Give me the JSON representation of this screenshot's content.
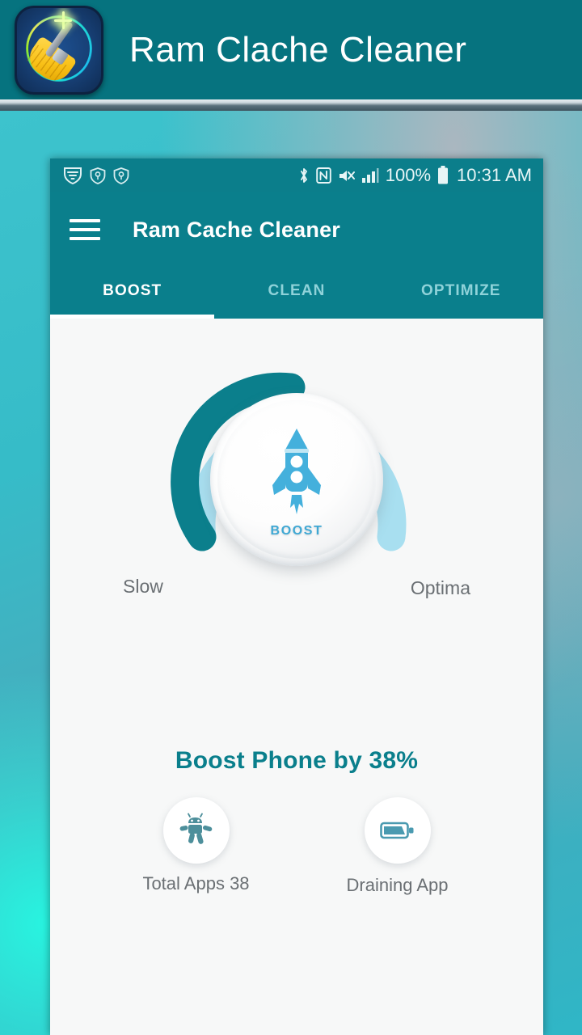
{
  "promo": {
    "title": "Ram Clache Cleaner",
    "icon_name": "broom-app-icon"
  },
  "phone": {
    "status_bar": {
      "left_icons": [
        "wifi-shield-icon",
        "key-shield-icon",
        "key-shield-icon"
      ],
      "right_icons": [
        "bluetooth-icon",
        "nfc-icon",
        "mute-icon",
        "signal-icon"
      ],
      "battery_percent": "100%",
      "battery_icon": "battery-full-icon",
      "time": "10:31 AM"
    },
    "app_bar": {
      "menu_icon": "hamburger-menu-icon",
      "title": "Ram Cache Cleaner"
    },
    "tabs": [
      {
        "label": "BOOST",
        "active": true
      },
      {
        "label": "CLEAN",
        "active": false
      },
      {
        "label": "OPTIMIZE",
        "active": false
      }
    ],
    "gauge": {
      "center_icon": "rocket-icon",
      "center_label": "BOOST",
      "progress_percent": 38,
      "left_label": "Slow",
      "right_label": "Optima",
      "track_color": "#a8dff0",
      "progress_color": "#0b7f8c"
    },
    "summary": "Boost Phone by 38%",
    "stats": [
      {
        "icon": "android-robot-icon",
        "label": "Total Apps 38"
      },
      {
        "icon": "battery-icon",
        "label": "Draining App"
      }
    ]
  },
  "colors": {
    "teal": "#0a7f8c",
    "promo_bg": "#06737f",
    "accent_blue": "#3fa8d4"
  }
}
